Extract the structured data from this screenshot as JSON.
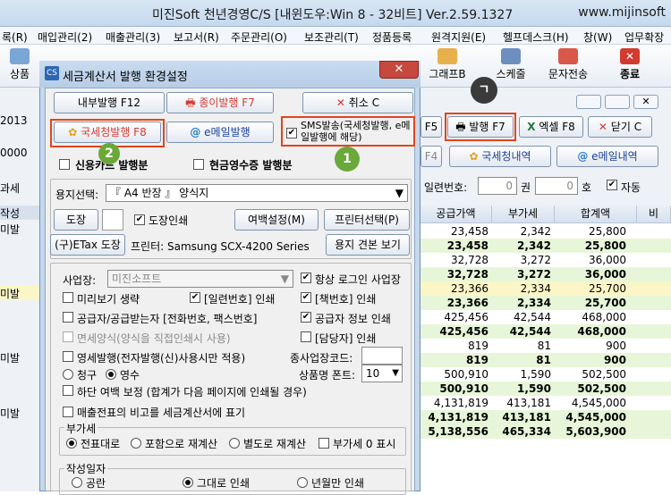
{
  "main": {
    "title": "미진Soft 천년경영C/S [내윈도우:Win 8 - 32비트] Ver.2.59.1327",
    "url": "www.mijinsoft",
    "menu": [
      "록(R)",
      "매입관리(2)",
      "매출관리(3)",
      "보고서(R)",
      "주문관리(O)",
      "보조관리(T)",
      "정품등록",
      "원격지원(E)",
      "헬프데스크(H)",
      "창(W)",
      "업무확장"
    ],
    "toolbar": [
      "상품",
      "그래프B",
      "스케줄",
      "문자전송",
      "종료"
    ],
    "left_labels": [
      "작",
      "2013",
      "0000",
      "과세",
      "작성",
      "미발",
      "미발",
      "미발",
      "미발"
    ],
    "right_panel": {
      "buttons": {
        "f5": "F5",
        "issue": "발행 F7",
        "excel": "엑셀 F8",
        "close": "닫기 C",
        "f4": "F4",
        "nts_list": "국세청내역",
        "email_list": "e메일내역"
      },
      "serial_label": "일련번호:",
      "serial_from": "0",
      "serial_kwon": "권",
      "serial_to": "0",
      "serial_ho": "호",
      "auto_label": "자동",
      "headers": [
        "공급가액",
        "부가세",
        "합계액",
        "비"
      ],
      "rows": [
        {
          "supply": "23,458",
          "vat": "2,342",
          "total": "25,800",
          "bold": false
        },
        {
          "supply": "23,458",
          "vat": "2,342",
          "total": "25,800",
          "bold": true
        },
        {
          "supply": "32,728",
          "vat": "3,272",
          "total": "36,000",
          "bold": false
        },
        {
          "supply": "32,728",
          "vat": "3,272",
          "total": "36,000",
          "bold": true
        },
        {
          "supply": "23,366",
          "vat": "2,334",
          "total": "25,700",
          "bold": false
        },
        {
          "supply": "23,366",
          "vat": "2,334",
          "total": "25,700",
          "bold": true
        },
        {
          "supply": "425,456",
          "vat": "42,544",
          "total": "468,000",
          "bold": false
        },
        {
          "supply": "425,456",
          "vat": "42,544",
          "total": "468,000",
          "bold": true
        },
        {
          "supply": "819",
          "vat": "81",
          "total": "900",
          "bold": false
        },
        {
          "supply": "819",
          "vat": "81",
          "total": "900",
          "bold": true
        },
        {
          "supply": "500,910",
          "vat": "1,590",
          "total": "502,500",
          "bold": false
        },
        {
          "supply": "500,910",
          "vat": "1,590",
          "total": "502,500",
          "bold": true
        },
        {
          "supply": "4,131,819",
          "vat": "413,181",
          "total": "4,545,000",
          "bold": false
        },
        {
          "supply": "4,131,819",
          "vat": "413,181",
          "total": "4,545,000",
          "bold": true
        },
        {
          "supply": "5,138,556",
          "vat": "465,334",
          "total": "5,603,900",
          "bold": true
        }
      ]
    }
  },
  "dialog": {
    "title": "세금계산서 발행 환경설정",
    "close_glyph": "✕",
    "buttons": {
      "internal": "내부발행 F12",
      "paper": "종이발행 F7",
      "cancel": "취소 C",
      "nts": "국세청발행 F8",
      "email": "e메일발행",
      "stamp": "도장",
      "margin": "여백설정(M)",
      "printer_select": "프린터선택(P)",
      "etax_stamp": "(구)ETax 도장",
      "preview": "용지 견본 보기"
    },
    "sms_label": "SMS발송(국세청발행, e메일발행에 해당)",
    "nts_issued_label": "신용카드 발행분",
    "cash_receipt_label": "현금영수증 발행분",
    "paper_select_label": "용지선택:",
    "paper_select_value": "『 A4 반장 』 양식지",
    "stamp_print_label": "도장인쇄",
    "printer_label": "프린터: Samsung SCX-4200 Series",
    "business_label": "사업장:",
    "business_value": "미진소프트",
    "options": {
      "always_login": "항상 로그인 사업장",
      "skip_preview": "미리보기 생략",
      "serial_print": "[일련번호] 인쇄",
      "book_print": "[책번호] 인쇄",
      "supplier_info": "공급자/공급받는자 [전화번호, 팩스번호]",
      "supplier_print": "공급자 정보 인쇄",
      "exempt_form": "면세양식(양식을 직접인쇄시 사용)",
      "manager_print": "[담당자] 인쇄",
      "zero_rate": "영세발행(전자발행(신)사용시만 적용)",
      "sub_biz_code": "종사업장코드:",
      "bottom_margin": "하단 여백 보정 (합계가 다음 페이지에 인쇄될 경우)",
      "remarks": "매출전표의 비고를 세금계산서에 표기"
    },
    "claim_label": "청구",
    "receipt_label": "영수",
    "font_label": "상품명 폰트:",
    "font_value": "10",
    "vat_group": {
      "title": "부가세",
      "opt1": "전표대로",
      "opt2": "포함으로 재계산",
      "opt3": "별도로 재계산",
      "opt4": "부가세 0 표시"
    },
    "date_group": {
      "title": "작성일자",
      "opt1": "공란",
      "opt2": "그대로 인쇄",
      "opt3": "년월만 인쇄"
    },
    "check": "✔"
  },
  "badges": {
    "one": "1",
    "two": "2",
    "seven": "ㄱ"
  },
  "colors": {
    "badge_green": "#6aa83a",
    "badge_dark": "#3a3a3a",
    "highlight": "#e0451f",
    "row_yellow": "#fbf6c7",
    "row_green": "#e7f6d8"
  }
}
